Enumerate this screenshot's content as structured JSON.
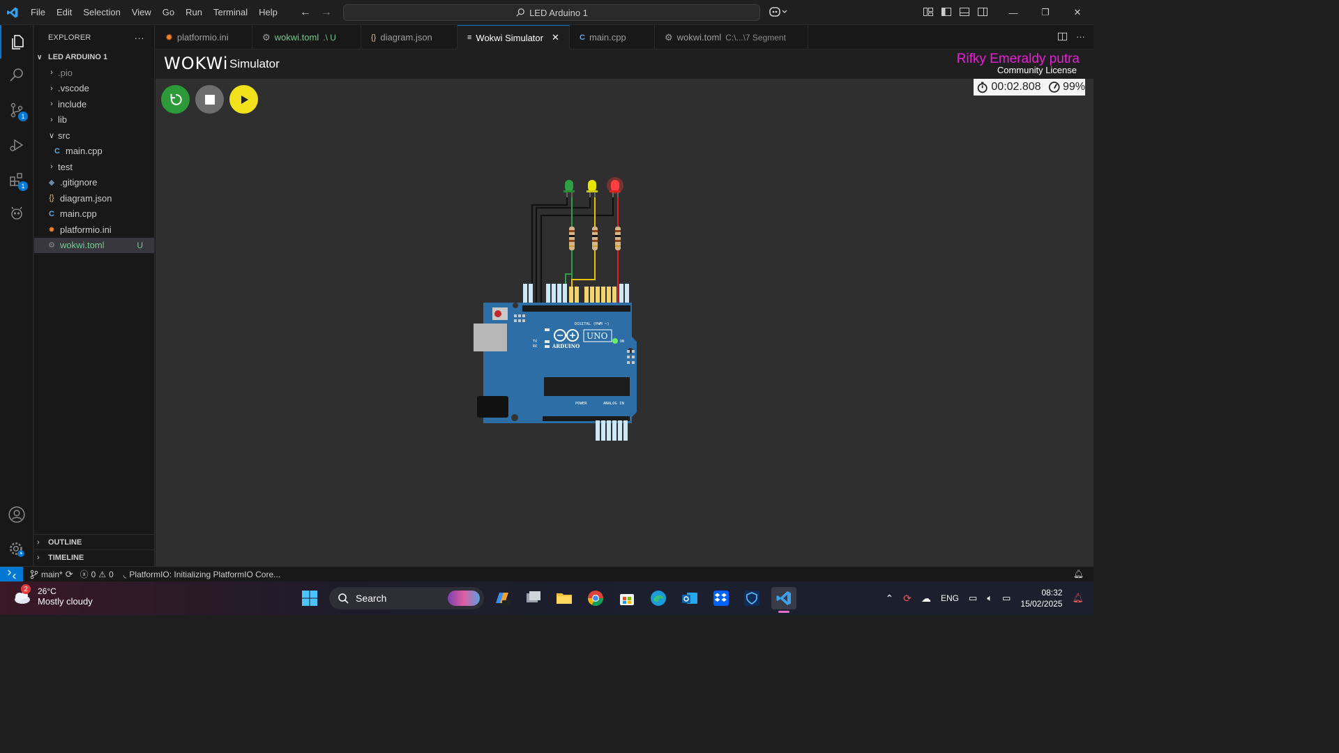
{
  "menu": [
    "File",
    "Edit",
    "Selection",
    "View",
    "Go",
    "Run",
    "Terminal",
    "Help"
  ],
  "command_center": "LED Arduino 1",
  "explorer": {
    "title": "EXPLORER",
    "project": "LED ARDUINO 1",
    "items": [
      {
        "label": ".pio",
        "type": "folder",
        "muted": true
      },
      {
        "label": ".vscode",
        "type": "folder"
      },
      {
        "label": "include",
        "type": "folder"
      },
      {
        "label": "lib",
        "type": "folder"
      },
      {
        "label": "src",
        "type": "folder-open"
      },
      {
        "label": "main.cpp",
        "type": "cpp"
      },
      {
        "label": "test",
        "type": "folder"
      },
      {
        "label": ".gitignore",
        "type": "git"
      },
      {
        "label": "diagram.json",
        "type": "json"
      },
      {
        "label": "main.cpp",
        "type": "cpp"
      },
      {
        "label": "platformio.ini",
        "type": "pio"
      },
      {
        "label": "wokwi.toml",
        "type": "toml",
        "git_status": "U"
      }
    ],
    "outline": "OUTLINE",
    "timeline": "TIMELINE"
  },
  "tabs": [
    {
      "label": "platformio.ini"
    },
    {
      "label": "wokwi.toml",
      "sub": ".\\ U"
    },
    {
      "label": "diagram.json"
    },
    {
      "label": "Wokwi Simulator",
      "active": true
    },
    {
      "label": "main.cpp"
    },
    {
      "label": "wokwi.toml",
      "sub": "C:\\...\\7 Segment"
    }
  ],
  "wokwi": {
    "logo": "WOKWi",
    "title": "Simulator",
    "license_user": "Rifky Emeraldy putra",
    "license_type": "Community License",
    "time": "00:02.808",
    "speed": "99%",
    "board_label": "UNO",
    "board_brand": "ARDUINO",
    "digital_label": "DIGITAL (PWM ~)",
    "analog_label": "ANALOG IN",
    "power_label": "POWER",
    "on_label": "ON",
    "tx_label": "TX",
    "rx_label": "RX"
  },
  "status": {
    "branch": "main*",
    "errors": "0",
    "warnings": "0",
    "message": "PlatformIO: Initializing PlatformIO Core..."
  },
  "taskbar": {
    "weather_badge": "2",
    "temperature": "26°C",
    "condition": "Mostly cloudy",
    "search": "Search",
    "language": "ENG",
    "time": "08:32",
    "date": "15/02/2025"
  },
  "colors": {
    "accent": "#0078d4",
    "license_user": "#e91ed8",
    "led_green": "#2ea043",
    "led_yellow": "#e6e600",
    "led_red": "#ff3b3b",
    "board": "#2d6ea6"
  }
}
